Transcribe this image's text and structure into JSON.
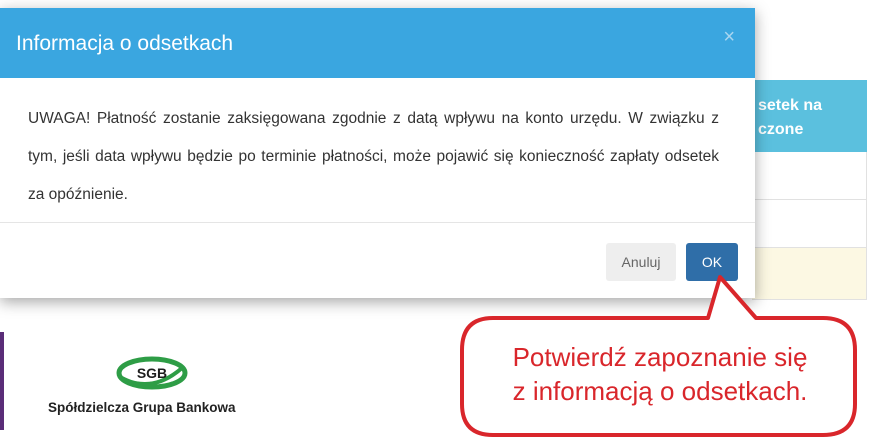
{
  "background_table": {
    "header_label": "setek na\nczone"
  },
  "modal": {
    "title": "Informacja o odsetkach",
    "close_glyph": "×",
    "body_text": "UWAGA! Płatność zostanie zaksięgowana zgodnie z datą wpływu na konto urzędu. W związku z tym, jeśli data wpływu będzie po terminie płatności, może pojawić się konieczność zapłaty odsetek za opóźnienie.",
    "cancel_label": "Anuluj",
    "ok_label": "OK"
  },
  "logo": {
    "badge_text": "SGB",
    "name": "Spółdzielcza Grupa Bankowa"
  },
  "callout": {
    "line1": "Potwierdź zapoznanie się",
    "line2": "z informacją o odsetkach."
  },
  "colors": {
    "modal_header": "#3aa6e0",
    "ok_button": "#2f6ea8",
    "table_header": "#5bc0de",
    "callout_red": "#d9262b",
    "highlight_row": "#fcf8e3"
  }
}
